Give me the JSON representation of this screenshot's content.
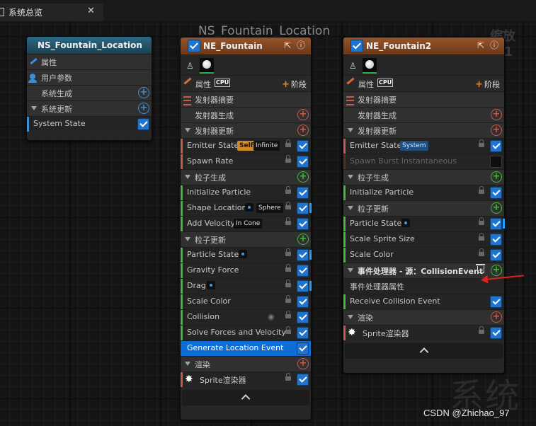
{
  "tab": {
    "title": "系统总览",
    "close": "✕"
  },
  "graph_title": "NS_Fountain_Location",
  "zoom_label": "缩放1:1",
  "watermark": "系统",
  "credit": "CSDN @Zhichao_97",
  "system_node": {
    "title": "NS_Fountain_Location",
    "rows": {
      "properties": "属性",
      "user_params": "用户参数",
      "system_spawn": "系统生成",
      "system_update": "系统更新",
      "system_state": "System State"
    }
  },
  "emitter1": {
    "title": "NE_Fountain",
    "properties": "属性",
    "cpu": "CPU",
    "stage": "阶段",
    "summary": "发射器摘要",
    "emitter_spawn": "发射器生成",
    "emitter_update": "发射器更新",
    "emitter_state": "Emitter State",
    "emitter_state_badge1": "Self",
    "emitter_state_badge2": "Infinite",
    "spawn_rate": "Spawn Rate",
    "particle_spawn": "粒子生成",
    "initialize_particle": "Initialize Particle",
    "shape_location": "Shape Location",
    "shape_location_badge": "Sphere",
    "add_velocity": "Add Velocity",
    "add_velocity_badge": "In Cone",
    "particle_update": "粒子更新",
    "particle_state": "Particle State",
    "gravity_force": "Gravity Force",
    "drag": "Drag",
    "scale_color": "Scale Color",
    "collision": "Collision",
    "solve_forces": "Solve Forces and Velocity",
    "generate_location_event": "Generate Location Event",
    "render": "渲染",
    "sprite_renderer": "Sprite渲染器"
  },
  "emitter2": {
    "title": "NE_Fountain2",
    "properties": "属性",
    "cpu": "CPU",
    "stage": "阶段",
    "summary": "发射器摘要",
    "emitter_spawn": "发射器生成",
    "emitter_update": "发射器更新",
    "emitter_state": "Emitter State",
    "emitter_state_badge": "System",
    "spawn_burst": "Spawn Burst Instantaneous",
    "particle_spawn": "粒子生成",
    "initialize_particle": "Initialize Particle",
    "particle_update": "粒子更新",
    "particle_state": "Particle State",
    "scale_sprite_size": "Scale Sprite Size",
    "scale_color": "Scale Color",
    "event_handler": "事件处理器 - 源：CollisionEvent",
    "event_handler_props": "事件处理器属性",
    "receive_collision": "Receive Collision Event",
    "render": "渲染",
    "sprite_renderer": "Sprite渲染器"
  },
  "colors": {
    "accent_blue": "#1f74d0",
    "selection": "#0d6fd6",
    "system_header": "#2d6a85",
    "emitter_header": "#98552b",
    "annotation_arrow": "#e02020"
  }
}
